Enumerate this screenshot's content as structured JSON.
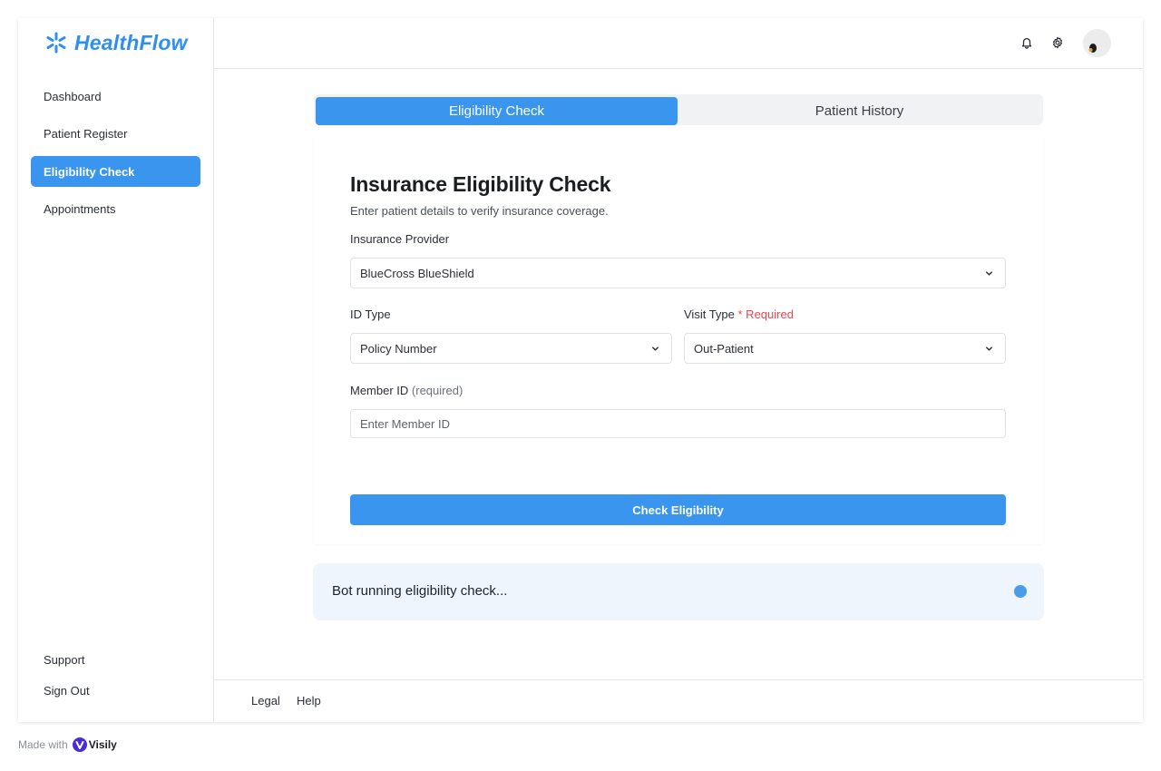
{
  "brand": {
    "name": "HealthFlow",
    "color": "#2f8ff0"
  },
  "sidebar": {
    "items": [
      {
        "label": "Dashboard",
        "active": false
      },
      {
        "label": "Patient Register",
        "active": false
      },
      {
        "label": "Eligibility Check",
        "active": true
      },
      {
        "label": "Appointments",
        "active": false
      }
    ],
    "bottom": {
      "support": "Support",
      "sign_out": "Sign Out"
    }
  },
  "header": {
    "icons": [
      "bell-icon",
      "gear-icon"
    ],
    "avatar": "user-avatar"
  },
  "tabs": [
    {
      "label": "Eligibility Check",
      "active": true
    },
    {
      "label": "Patient History",
      "active": false
    }
  ],
  "form": {
    "title": "Insurance Eligibility Check",
    "subtitle": "Enter patient details to verify insurance coverage.",
    "provider": {
      "label": "Insurance Provider",
      "value": "BlueCross BlueShield"
    },
    "id_type": {
      "label": "ID Type",
      "value": "Policy Number"
    },
    "visit_type": {
      "label": "Visit Type",
      "required_text": "* Required",
      "value": "Out-Patient"
    },
    "member_id": {
      "label": "Member ID",
      "note": "(required)",
      "placeholder": "Enter Member ID",
      "value": ""
    },
    "submit_label": "Check Eligibility"
  },
  "status": {
    "text": "Bot running eligibility check...",
    "dot_color": "#4a9ce8"
  },
  "footer": {
    "legal": "Legal",
    "help": "Help"
  },
  "watermark": {
    "prefix": "Made with",
    "brand": "Visily"
  },
  "colors": {
    "accent": "#3a95ef",
    "required": "#e5484d",
    "status_bg": "#eef5fd"
  }
}
